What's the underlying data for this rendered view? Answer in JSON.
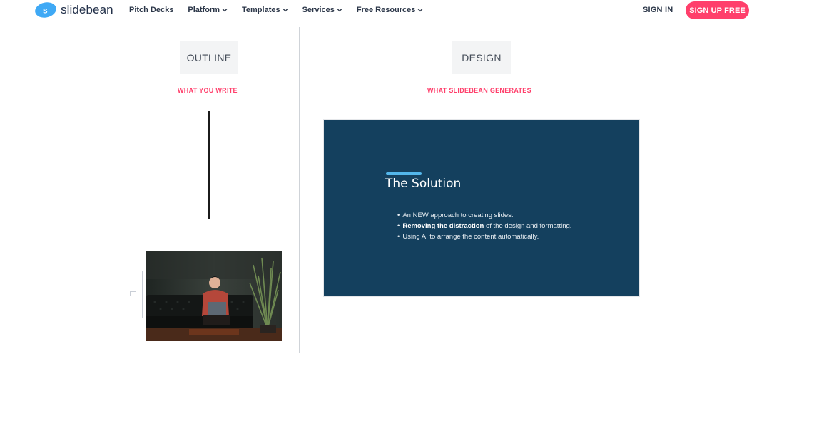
{
  "brand": {
    "name": "slidebean",
    "accent": "#ff3f6b",
    "logo_color": "#3fa9f5"
  },
  "nav": {
    "items": [
      {
        "label": "Pitch Decks",
        "has_dropdown": false
      },
      {
        "label": "Platform",
        "has_dropdown": true
      },
      {
        "label": "Templates",
        "has_dropdown": true
      },
      {
        "label": "Services",
        "has_dropdown": true
      },
      {
        "label": "Free Resources",
        "has_dropdown": true
      }
    ],
    "sign_in": "SIGN IN",
    "sign_up": "SIGN UP FREE"
  },
  "left": {
    "tag": "OUTLINE",
    "caption": "WHAT YOU WRITE"
  },
  "right": {
    "tag": "DESIGN",
    "caption": "WHAT SLIDEBEAN GENERATES",
    "slide": {
      "background": "#14405e",
      "title": "The Solution",
      "bullets": [
        {
          "bold": "",
          "text": "An NEW approach to creating slides."
        },
        {
          "bold": "Removing the distraction",
          "text": " of the design and formatting."
        },
        {
          "bold": "",
          "text": "Using AI to arrange the content automatically."
        }
      ]
    }
  }
}
